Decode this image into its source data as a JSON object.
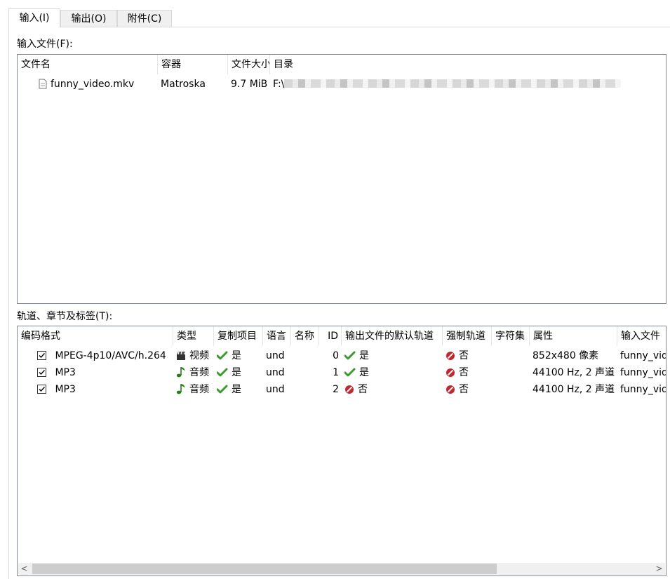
{
  "tabs": [
    {
      "label": "输入(I)",
      "active": true
    },
    {
      "label": "输出(O)",
      "active": false
    },
    {
      "label": "附件(C)",
      "active": false
    }
  ],
  "input_files": {
    "label": "输入文件(F):",
    "columns": [
      "文件名",
      "容器",
      "文件大小",
      "目录"
    ],
    "rows": [
      {
        "name": "funny_video.mkv",
        "container": "Matroska",
        "size": "9.7 MiB",
        "dir": "F:\\"
      }
    ]
  },
  "tracks": {
    "label": "轨道、章节及标签(T):",
    "columns": [
      "编码格式",
      "类型",
      "复制项目",
      "语言",
      "名称",
      "ID",
      "输出文件的默认轨道",
      "强制轨道",
      "字符集",
      "属性",
      "输入文件"
    ],
    "rows": [
      {
        "checked": true,
        "codec": "MPEG-4p10/AVC/h.264",
        "type_icon": "film-icon",
        "type": "视频",
        "copy": "是",
        "lang": "und",
        "name": "",
        "id": "0",
        "default_icon": "check-icon",
        "default": "是",
        "forced": "否",
        "charset": "",
        "props": "852x480 像素",
        "file": "funny_video.mkv"
      },
      {
        "checked": true,
        "codec": "MP3",
        "type_icon": "music-note-icon",
        "type": "音频",
        "copy": "是",
        "lang": "und",
        "name": "",
        "id": "1",
        "default_icon": "check-icon",
        "default": "是",
        "forced": "否",
        "charset": "",
        "props": "44100 Hz, 2 声道",
        "file": "funny_video.mkv"
      },
      {
        "checked": true,
        "codec": "MP3",
        "type_icon": "music-note-icon",
        "type": "音频",
        "copy": "是",
        "lang": "und",
        "name": "",
        "id": "2",
        "default_icon": "no-icon",
        "default": "否",
        "forced": "否",
        "charset": "",
        "props": "44100 Hz, 2 声道",
        "file": "funny_video.mkv"
      }
    ]
  },
  "scrollbar": {
    "left_arrow": "<",
    "right_arrow": ">"
  },
  "colors": {
    "border": "#828790",
    "check_green": "#3a9c2e",
    "no_red": "#c1272d"
  }
}
